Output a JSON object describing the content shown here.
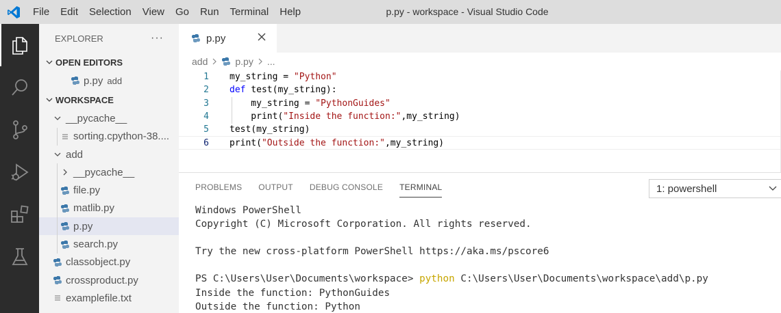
{
  "window_title": "p.py - workspace - Visual Studio Code",
  "menu": [
    "File",
    "Edit",
    "Selection",
    "View",
    "Go",
    "Run",
    "Terminal",
    "Help"
  ],
  "activity_bar": [
    "files-icon",
    "search-icon",
    "source-control-icon",
    "run-debug-icon",
    "extensions-icon",
    "testing-icon"
  ],
  "sidebar": {
    "title": "EXPLORER",
    "more": "···",
    "open_editors": {
      "label": "OPEN EDITORS",
      "items": [
        {
          "name": "p.py",
          "desc": "add"
        }
      ]
    },
    "workspace": {
      "label": "WORKSPACE",
      "items": [
        {
          "name": "__pycache__",
          "kind": "folder-open"
        },
        {
          "name": "sorting.cpython-38....",
          "kind": "file"
        },
        {
          "name": "add",
          "kind": "folder-open"
        },
        {
          "name": "__pycache__",
          "kind": "folder-closed"
        },
        {
          "name": "file.py",
          "kind": "python"
        },
        {
          "name": "matlib.py",
          "kind": "python"
        },
        {
          "name": "p.py",
          "kind": "python"
        },
        {
          "name": "search.py",
          "kind": "python"
        },
        {
          "name": "classobject.py",
          "kind": "python"
        },
        {
          "name": "crossproduct.py",
          "kind": "python"
        },
        {
          "name": "examplefile.txt",
          "kind": "file"
        }
      ]
    }
  },
  "editor": {
    "tab_label": "p.py",
    "breadcrumb": [
      "add",
      "p.py",
      "..."
    ],
    "line_numbers": [
      "1",
      "2",
      "3",
      "4",
      "5",
      "6"
    ],
    "lines": [
      "my_string = \"Python\"",
      "def test(my_string):",
      "    my_string = \"PythonGuides\"",
      "    print(\"Inside the function:\",my_string)",
      "test(my_string)",
      "print(\"Outside the function:\",my_string)"
    ]
  },
  "panel": {
    "tabs": [
      "PROBLEMS",
      "OUTPUT",
      "DEBUG CONSOLE",
      "TERMINAL"
    ],
    "active_tab": "TERMINAL",
    "terminal_select": "1: powershell",
    "terminal_lines": [
      "Windows PowerShell",
      "Copyright (C) Microsoft Corporation. All rights reserved.",
      "",
      "Try the new cross-platform PowerShell https://aka.ms/pscore6",
      "",
      "PS C:\\Users\\User\\Documents\\workspace> ",
      "Inside the function: PythonGuides",
      "Outside the function: Python"
    ],
    "prompt_command": "python",
    "prompt_args": " C:\\Users\\User\\Documents\\workspace\\add\\p.py"
  },
  "colors": {
    "accent": "#007acc",
    "python_icon": "#3c78aa",
    "keyword": "#0000ff",
    "string": "#a31515",
    "command": "#c7a600"
  }
}
